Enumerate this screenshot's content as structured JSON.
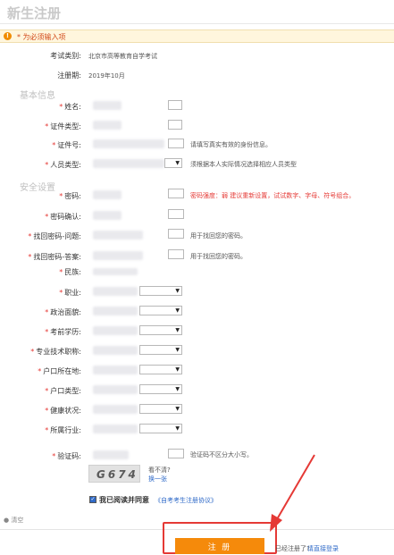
{
  "title": "新生注册",
  "notice": {
    "icon": "!",
    "text": "* 为必须输入项"
  },
  "exam_type": {
    "label": "考试类别:",
    "value": "北京市高等教育自学考试"
  },
  "register_period": {
    "label": "注册期:",
    "value": "2019年10月"
  },
  "section_basic": "基本信息",
  "name_label": "姓名:",
  "id_type_label": "证件类型:",
  "id_number_label": "证件号:",
  "id_number_hint": "请填写真实有效的身份信息。",
  "person_type_label": "人员类型:",
  "person_type_hint": "须根据本人实际情况选择相应人员类型",
  "section_security": "安全设置",
  "password_label": "密码:",
  "password_hint": "密码强度：弱 建议重新设置，试试数字、字母、符号组合。",
  "password_confirm_label": "密码确认:",
  "recover_question_label": "找回密码-问题:",
  "recover_question_hint": "用于找回您的密码。",
  "recover_answer_label": "找回密码-答案:",
  "recover_answer_hint": "用于找回您的密码。",
  "ethnicity_label": "民族:",
  "occupation_label": "职业:",
  "political_label": "政治面貌:",
  "education_label": "考前学历:",
  "professional_title_label": "专业技术职称:",
  "hukou_location_label": "户口所在地:",
  "hukou_type_label": "户口类型:",
  "health_label": "健康状况:",
  "industry_label": "所属行业:",
  "captcha_label": "验证码:",
  "captcha_hint": "验证码不区分大小写。",
  "captcha_image_text": "G674",
  "captcha_unclear": "看不清?",
  "captcha_refresh": "换一张",
  "agree_label": "我已阅读并同意",
  "agree_link": "《自考考生注册协议》",
  "clear_link": "清空",
  "submit_label": "注 册",
  "login_prompt": "已经注册了?",
  "login_link": "请直接登录",
  "colors": {
    "accent": "#f58a0b",
    "required": "#e53935",
    "link": "#2f6ac8",
    "highlight": "#e53935"
  },
  "icons": {
    "notice": "warning-icon",
    "select": "chevron-down-icon",
    "checkbox": "checkmark-icon"
  }
}
